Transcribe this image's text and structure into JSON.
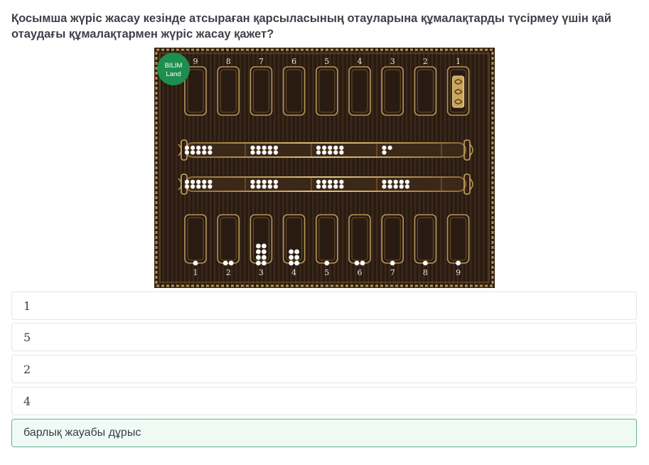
{
  "question": {
    "text": "Қосымша жүріс жасау кезінде атсыраған қарсыласының отауларына құмалақтарды түсірмеу үшін қай отаудағы құмалақтармен жүріс жасау қажет?"
  },
  "board": {
    "logo_line1": "BILIM",
    "logo_line2": "Land",
    "top_labels": [
      "9",
      "8",
      "7",
      "6",
      "5",
      "4",
      "3",
      "2",
      "1"
    ],
    "bottom_labels": [
      "1",
      "2",
      "3",
      "4",
      "5",
      "6",
      "7",
      "8",
      "9"
    ],
    "top_counts": [
      0,
      0,
      0,
      0,
      0,
      0,
      0,
      0,
      0
    ],
    "bottom_counts": [
      1,
      2,
      8,
      6,
      1,
      2,
      1,
      1,
      1
    ],
    "kazan_top": [
      10,
      10,
      10,
      3
    ],
    "kazan_bottom": [
      10,
      10,
      10,
      10
    ],
    "tuzdyk_top_index": 8
  },
  "options": [
    {
      "label": "1"
    },
    {
      "label": "5"
    },
    {
      "label": "2"
    },
    {
      "label": "4"
    },
    {
      "label": "барлық жауабы дұрыс"
    }
  ]
}
